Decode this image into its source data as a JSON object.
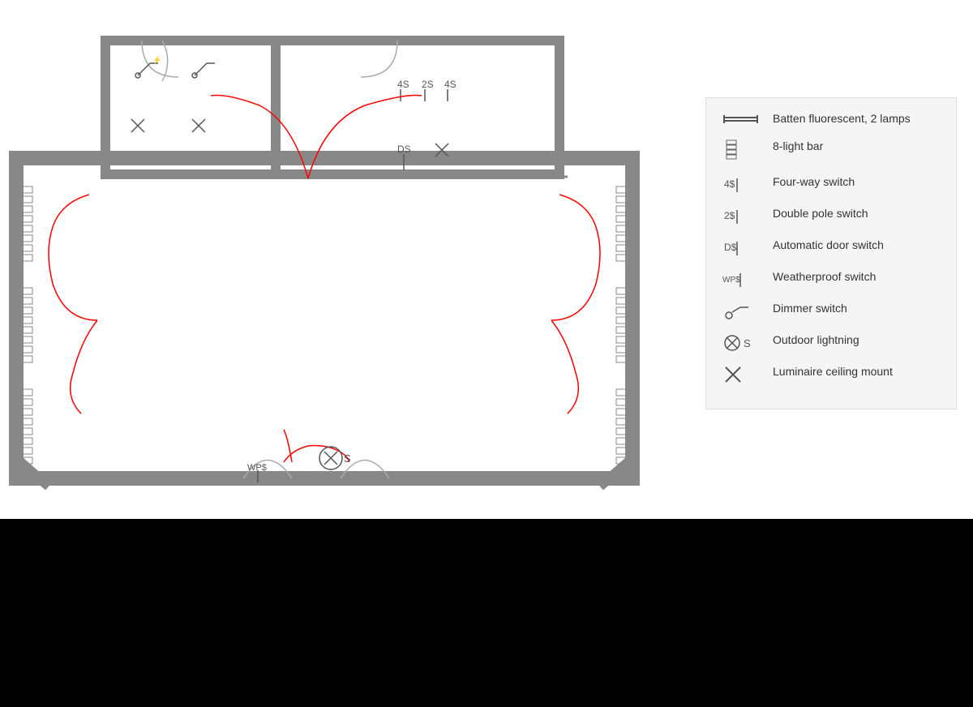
{
  "legend": {
    "items": [
      {
        "symbol": "batten-fluorescent",
        "label": "Batten fluorescent, 2 lamps"
      },
      {
        "symbol": "8-light-bar",
        "label": "8-light bar"
      },
      {
        "symbol": "four-way-switch",
        "label": "Four-way switch"
      },
      {
        "symbol": "double-pole-switch",
        "label": "Double pole switch"
      },
      {
        "symbol": "automatic-door-switch",
        "label": "Automatic door switch"
      },
      {
        "symbol": "weatherproof-switch",
        "label": "Weatherproof switch"
      },
      {
        "symbol": "dimmer-switch",
        "label": "Dimmer switch"
      },
      {
        "symbol": "outdoor-lightning",
        "label": "Outdoor lightning"
      },
      {
        "symbol": "luminaire-ceiling-mount",
        "label": "Luminaire ceiling mount"
      }
    ]
  }
}
